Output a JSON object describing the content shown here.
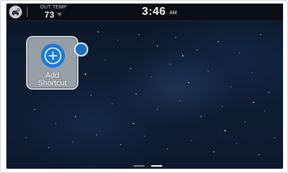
{
  "status_bar": {
    "car_icon": "car-settings-icon",
    "temperature_label": "OUT TEMP",
    "temperature_value": "73",
    "temperature_unit": "°F",
    "time": "3:46",
    "period": "AM"
  },
  "shortcut": {
    "icon": "plus-circle-icon",
    "label_line1": "Add",
    "label_line2": "Shortcut",
    "accent_color": "#1f7ad6"
  },
  "page_indicator": {
    "page_count": 2,
    "active_page": 2
  }
}
